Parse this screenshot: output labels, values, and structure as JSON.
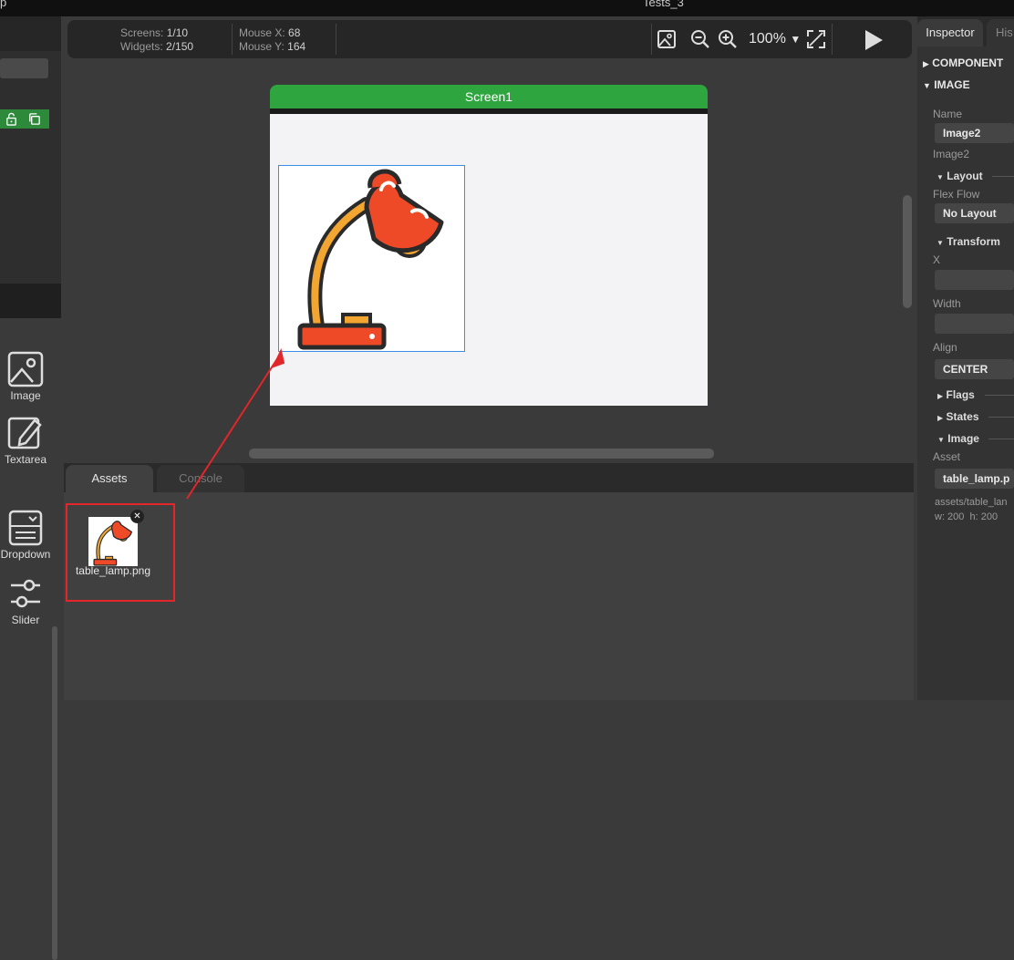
{
  "titlebar": {
    "left_fragment": "p",
    "center_fragment": "Tests_3"
  },
  "toolbar": {
    "screens_label": "Screens:",
    "screens_value": "1/10",
    "widgets_label": "Widgets:",
    "widgets_value": "2/150",
    "mouse_x_label": "Mouse X:",
    "mouse_x_value": "68",
    "mouse_y_label": "Mouse Y:",
    "mouse_y_value": "164",
    "zoom": "100%"
  },
  "canvas": {
    "screen_title": "Screen1"
  },
  "widgets_panel": {
    "items": [
      {
        "label": "Image",
        "icon": "image-icon"
      },
      {
        "label": "Textarea",
        "icon": "edit-icon"
      },
      {
        "label": "Dropdown",
        "icon": "dropdown-icon"
      },
      {
        "label": "Slider",
        "icon": "slider-icon"
      }
    ]
  },
  "bottom": {
    "tabs": [
      {
        "label": "Assets"
      },
      {
        "label": "Console"
      }
    ],
    "assets": [
      {
        "name": "table_lamp.png"
      }
    ]
  },
  "inspector": {
    "tabs": [
      {
        "label": "Inspector"
      },
      {
        "label": "His"
      }
    ],
    "section_component": "COMPONENT",
    "section_image": "IMAGE",
    "name_label": "Name",
    "name_value": "Image2",
    "id_text": "Image2",
    "layout_label": "Layout",
    "flex_flow_label": "Flex Flow",
    "flex_flow_value": "No Layout",
    "transform_label": "Transform",
    "x_label": "X",
    "x_value": "",
    "width_label": "Width",
    "width_value": "",
    "align_label": "Align",
    "align_value": "CENTER",
    "flags_label": "Flags",
    "states_label": "States",
    "image_sub_label": "Image",
    "asset_label": "Asset",
    "asset_value": "table_lamp.p",
    "asset_path": "assets/table_lan",
    "asset_size": "w: 200  h: 200"
  },
  "colors": {
    "screen_header": "#2fa53f",
    "selection": "#3a8ee6",
    "annotation_red": "#e2262a",
    "lamp_red": "#ef4a28",
    "lamp_orange": "#f2a531"
  }
}
